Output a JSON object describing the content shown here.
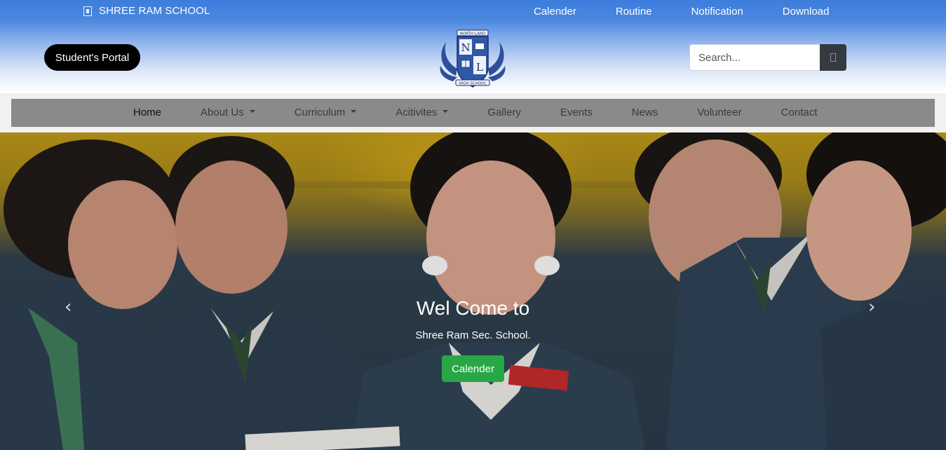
{
  "brand": {
    "name": "SHREE RAM SCHOOL",
    "icon": "school-icon"
  },
  "top_links": [
    "Calender",
    "Routine",
    "Notification",
    "Download"
  ],
  "portal_button": "Student's Portal",
  "logo": {
    "top_text": "NORTH LAND",
    "letters": "N L",
    "bottom_text": "HIGH SCHOOL"
  },
  "search": {
    "placeholder": "Search...",
    "button_icon": "search-icon"
  },
  "nav": {
    "items": [
      {
        "label": "Home",
        "dropdown": false,
        "active": true
      },
      {
        "label": "About Us",
        "dropdown": true,
        "active": false
      },
      {
        "label": "Curriculum",
        "dropdown": true,
        "active": false
      },
      {
        "label": "Acitivites",
        "dropdown": true,
        "active": false
      },
      {
        "label": "Gallery",
        "dropdown": false,
        "active": false
      },
      {
        "label": "Events",
        "dropdown": false,
        "active": false
      },
      {
        "label": "News",
        "dropdown": false,
        "active": false
      },
      {
        "label": "Volunteer",
        "dropdown": false,
        "active": false
      },
      {
        "label": "Contact",
        "dropdown": false,
        "active": false
      }
    ]
  },
  "hero": {
    "title": "Wel Come to",
    "subtitle": "Shree Ram Sec. School.",
    "button": "Calender",
    "prev_icon": "chevron-left-icon",
    "next_icon": "chevron-right-icon"
  },
  "colors": {
    "header_top": "#3d7ddc",
    "nav_bg": "#8a8a8a",
    "cta_green": "#28a745",
    "search_button": "#343a40"
  }
}
